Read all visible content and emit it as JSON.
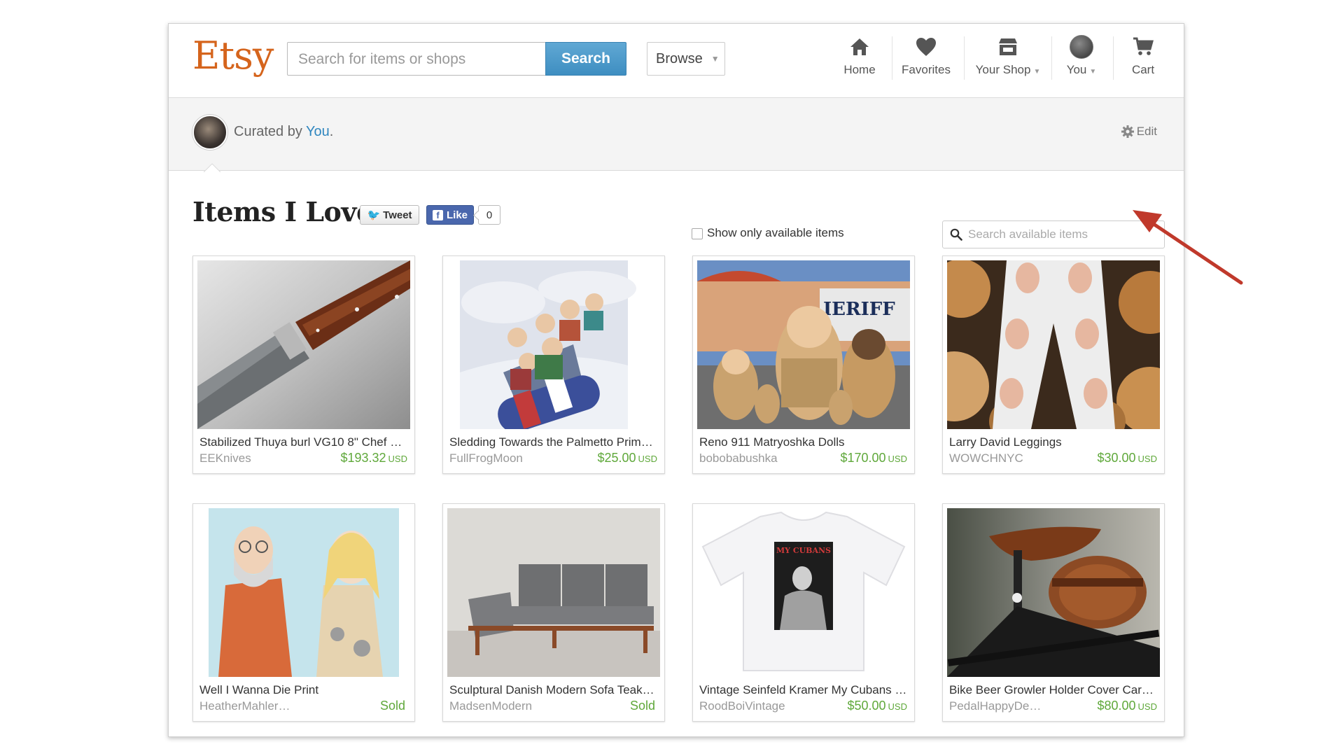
{
  "header": {
    "logo": "Etsy",
    "search_placeholder": "Search for items or shops",
    "search_button": "Search",
    "browse_label": "Browse",
    "nav": {
      "home": "Home",
      "favorites": "Favorites",
      "your_shop": "Your Shop",
      "you": "You",
      "cart": "Cart"
    }
  },
  "curator": {
    "prefix": "Curated by ",
    "name": "You",
    "suffix": ".",
    "edit_label": "Edit"
  },
  "section": {
    "title": "Items I Love",
    "tweet_label": "Tweet",
    "like_label": "Like",
    "like_count": "0",
    "available_only_label": "Show only available items",
    "available_only_checked": false,
    "search_placeholder": "Search available items"
  },
  "colors": {
    "brand": "#d5641c",
    "link": "#2f86bf",
    "price": "#5fa83a",
    "search_button": "#4b9bcc",
    "annotation_arrow": "#c0392b"
  },
  "items": [
    {
      "title": "Stabilized Thuya burl VG10 8\" Chef …",
      "shop": "EEKnives",
      "price": "$193.32",
      "currency": "USD"
    },
    {
      "title": "Sledding Towards the Palmetto Prim…",
      "shop": "FullFrogMoon",
      "price": "$25.00",
      "currency": "USD"
    },
    {
      "title": "Reno 911 Matryoshka Dolls",
      "shop": "bobobabushka",
      "price": "$170.00",
      "currency": "USD"
    },
    {
      "title": "Larry David Leggings",
      "shop": "WOWCHNYC",
      "price": "$30.00",
      "currency": "USD"
    },
    {
      "title": "Well I Wanna Die Print",
      "shop": "HeatherMahler…",
      "price": "Sold",
      "currency": ""
    },
    {
      "title": "Sculptural Danish Modern Sofa Teak…",
      "shop": "MadsenModern",
      "price": "Sold",
      "currency": ""
    },
    {
      "title": "Vintage Seinfeld Kramer My Cubans …",
      "shop": "RoodBoiVintage",
      "price": "$50.00",
      "currency": "USD"
    },
    {
      "title": "Bike Beer Growler Holder Cover Car…",
      "shop": "PedalHappyDe…",
      "price": "$80.00",
      "currency": "USD"
    }
  ],
  "tshirt_print_text": "MY CUBANS"
}
